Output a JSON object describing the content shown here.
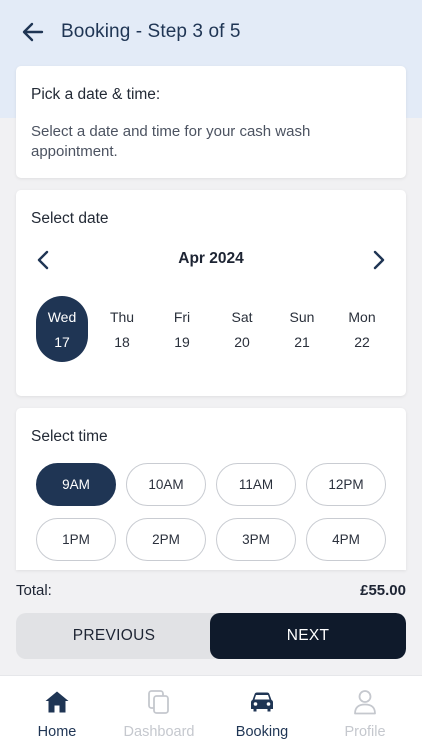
{
  "header": {
    "title": "Booking - Step 3 of 5",
    "back_icon": "arrow-left-icon"
  },
  "intro": {
    "heading": "Pick a date & time:",
    "description": "Select a date and time for your cash wash appointment."
  },
  "date_picker": {
    "heading": "Select date",
    "month": "Apr 2024",
    "days": [
      {
        "name": "Wed",
        "num": "17",
        "selected": true
      },
      {
        "name": "Thu",
        "num": "18",
        "selected": false
      },
      {
        "name": "Fri",
        "num": "19",
        "selected": false
      },
      {
        "name": "Sat",
        "num": "20",
        "selected": false
      },
      {
        "name": "Sun",
        "num": "21",
        "selected": false
      },
      {
        "name": "Mon",
        "num": "22",
        "selected": false
      }
    ]
  },
  "time_picker": {
    "heading": "Select time",
    "slots": [
      {
        "label": "9AM",
        "selected": true
      },
      {
        "label": "10AM",
        "selected": false
      },
      {
        "label": "11AM",
        "selected": false
      },
      {
        "label": "12PM",
        "selected": false
      },
      {
        "label": "1PM",
        "selected": false
      },
      {
        "label": "2PM",
        "selected": false
      },
      {
        "label": "3PM",
        "selected": false
      },
      {
        "label": "4PM",
        "selected": false
      }
    ]
  },
  "total": {
    "label": "Total:",
    "value": "£55.00"
  },
  "actions": {
    "previous_label": "PREVIOUS",
    "next_label": "NEXT"
  },
  "tabbar": {
    "tabs": [
      {
        "label": "Home",
        "icon": "home-icon",
        "active": true
      },
      {
        "label": "Dashboard",
        "icon": "copy-icon",
        "active": false
      },
      {
        "label": "Booking",
        "icon": "car-icon",
        "active": true
      },
      {
        "label": "Profile",
        "icon": "user-icon",
        "active": false
      }
    ]
  },
  "colors": {
    "primary": "#1f3554",
    "next_button": "#0f1a2b",
    "header_bg": "#e3ebf7",
    "inactive_tab": "#c5c8ce"
  }
}
